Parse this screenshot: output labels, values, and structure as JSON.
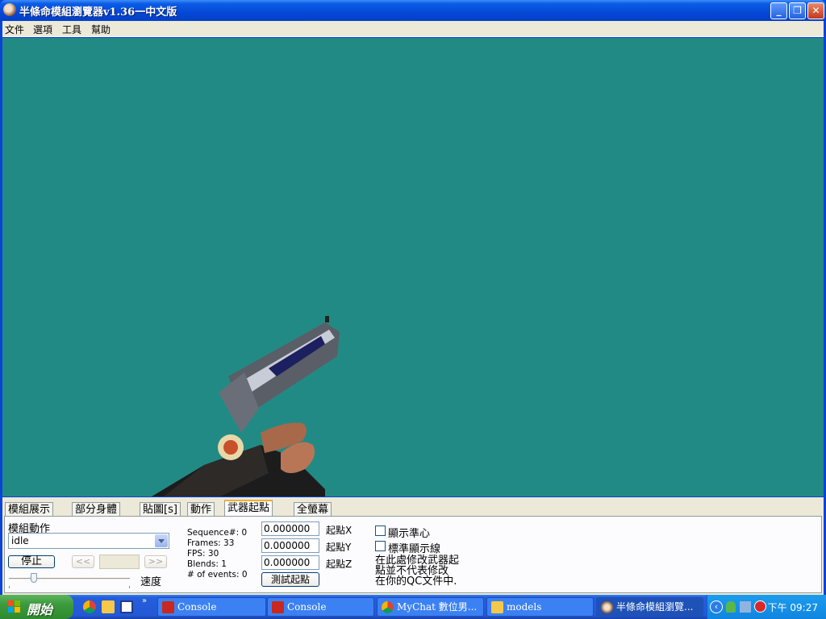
{
  "window": {
    "title": "半條命模組瀏覽器v1.36一中文版",
    "menu": [
      "文件",
      "選項",
      "工具",
      "幫助"
    ]
  },
  "colors": {
    "viewport": "#228a84",
    "titlebar": "#0a5ce6",
    "panel": "#ece9d8"
  },
  "tabs": [
    "模組展示",
    "部分身體",
    "貼圖[s]",
    "動作",
    "武器起點",
    "全螢幕"
  ],
  "active_tab": "武器起點",
  "animation_panel": {
    "label": "模組動作",
    "selected": "idle",
    "stop_button": "停止",
    "prev_button": "<<",
    "next_button": ">>",
    "speed_label": "速度"
  },
  "sequence_info": [
    "Sequence#: 0",
    "Frames: 33",
    "FPS: 30",
    "Blends: 1",
    "# of events: 0"
  ],
  "origin": {
    "x_value": "0.000000",
    "y_value": "0.000000",
    "z_value": "0.000000",
    "x_label": "起點X",
    "y_label": "起點Y",
    "z_label": "起點Z",
    "test_button": "測試起點"
  },
  "options": {
    "show_center": "顯示準心",
    "show_guide": "標準顯示線",
    "note_line1": "在此處修改武器起",
    "note_line2": "點並不代表修改",
    "note_line3": "在你的QC文件中."
  },
  "taskbar": {
    "start_label": "開始",
    "tasks": [
      "Console",
      "Console",
      "MyChat 數位男...",
      "models",
      "半條命模組瀏覽..."
    ],
    "clock": "下午 09:27"
  }
}
